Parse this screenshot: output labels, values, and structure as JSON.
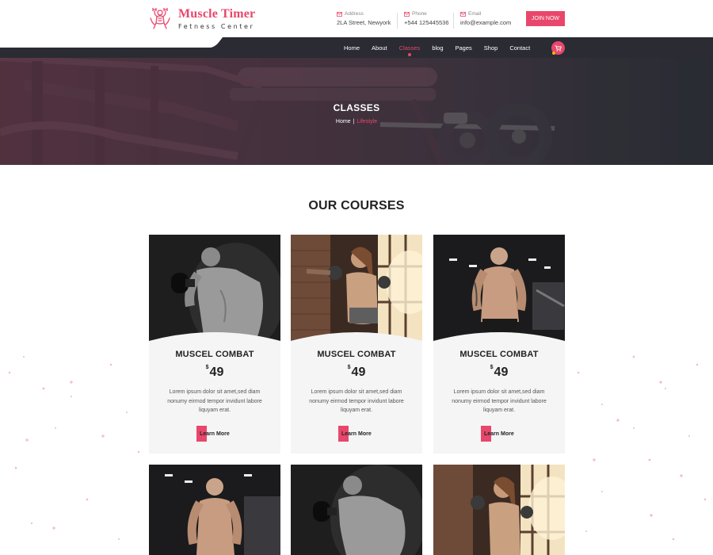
{
  "brand": {
    "name": "Muscle Timer",
    "tagline": "Fetness Center"
  },
  "contact": {
    "address": {
      "label": "Address",
      "value": "2LA Street, Newyork",
      "icon": "envelope-icon"
    },
    "phone": {
      "label": "Phone",
      "value": "+544 125445536",
      "icon": "envelope-icon"
    },
    "email": {
      "label": "Email",
      "value": "info@example.com",
      "icon": "envelope-icon"
    }
  },
  "header": {
    "join_label": "JOIN NOW"
  },
  "nav": {
    "items": [
      "Home",
      "About",
      "Classes",
      "blog",
      "Pages",
      "Shop",
      "Contact"
    ],
    "active": "Classes",
    "cart_icon": "cart-icon"
  },
  "hero": {
    "title": "CLASSES",
    "breadcrumb": {
      "home": "Home",
      "separator": "|",
      "current": "Lifestyle"
    }
  },
  "courses": {
    "title": "OUR COURSES",
    "items": [
      {
        "title": "MUSCEL COMBAT",
        "currency": "$",
        "price": "49",
        "description": "Lorem ipsum dolor sit amet,sed diam nonumy eirmod tempor invidunt labore liquyam erat.",
        "button": "Learn More",
        "photo": "man-dumbbell-bw"
      },
      {
        "title": "MUSCEL COMBAT",
        "currency": "$",
        "price": "49",
        "description": "Lorem ipsum dolor sit amet,sed diam nonumy eirmod tempor invidunt labore liquyam erat.",
        "button": "Learn More",
        "photo": "woman-boxing"
      },
      {
        "title": "MUSCEL COMBAT",
        "currency": "$",
        "price": "49",
        "description": "Lorem ipsum dolor sit amet,sed diam nonumy eirmod tempor invidunt labore liquyam erat.",
        "button": "Learn More",
        "photo": "man-gym-standing"
      },
      {
        "photo": "man-gym-standing"
      },
      {
        "photo": "man-dumbbell-bw"
      },
      {
        "photo": "woman-boxing"
      }
    ]
  },
  "colors": {
    "accent": "#e8476b",
    "nav_bg": "#2a2b33",
    "card_bg": "#f5f5f6"
  }
}
